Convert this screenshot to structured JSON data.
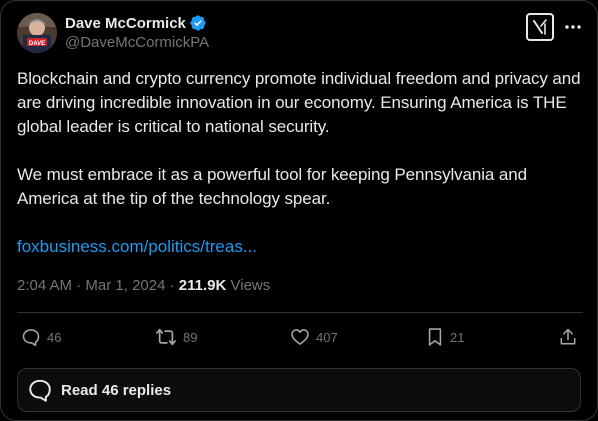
{
  "author": {
    "display_name": "Dave McCormick",
    "handle": "@DaveMcCormickPA",
    "verified": true,
    "avatar_label": "DAVE"
  },
  "tweet": {
    "paragraphs": [
      "Blockchain and crypto currency promote individual freedom and privacy and are driving incredible innovation in our economy. Ensuring America is THE global leader is critical to national security.",
      "We must embrace it as a powerful tool for keeping Pennsylvania and America at the tip of the technology spear."
    ],
    "link_text": "foxbusiness.com/politics/treas...",
    "time": "2:04 AM",
    "date": "Mar 1, 2024",
    "views_count": "211.9K",
    "views_label": "Views"
  },
  "actions": {
    "replies": "46",
    "reposts": "89",
    "likes": "407",
    "bookmarks": "21"
  },
  "read_replies_label": "Read 46 replies",
  "colors": {
    "background": "#000000",
    "text": "#e7e9ea",
    "muted": "#71767b",
    "link": "#1d9bf0",
    "verified": "#1d9bf0",
    "border": "#2f3336"
  }
}
